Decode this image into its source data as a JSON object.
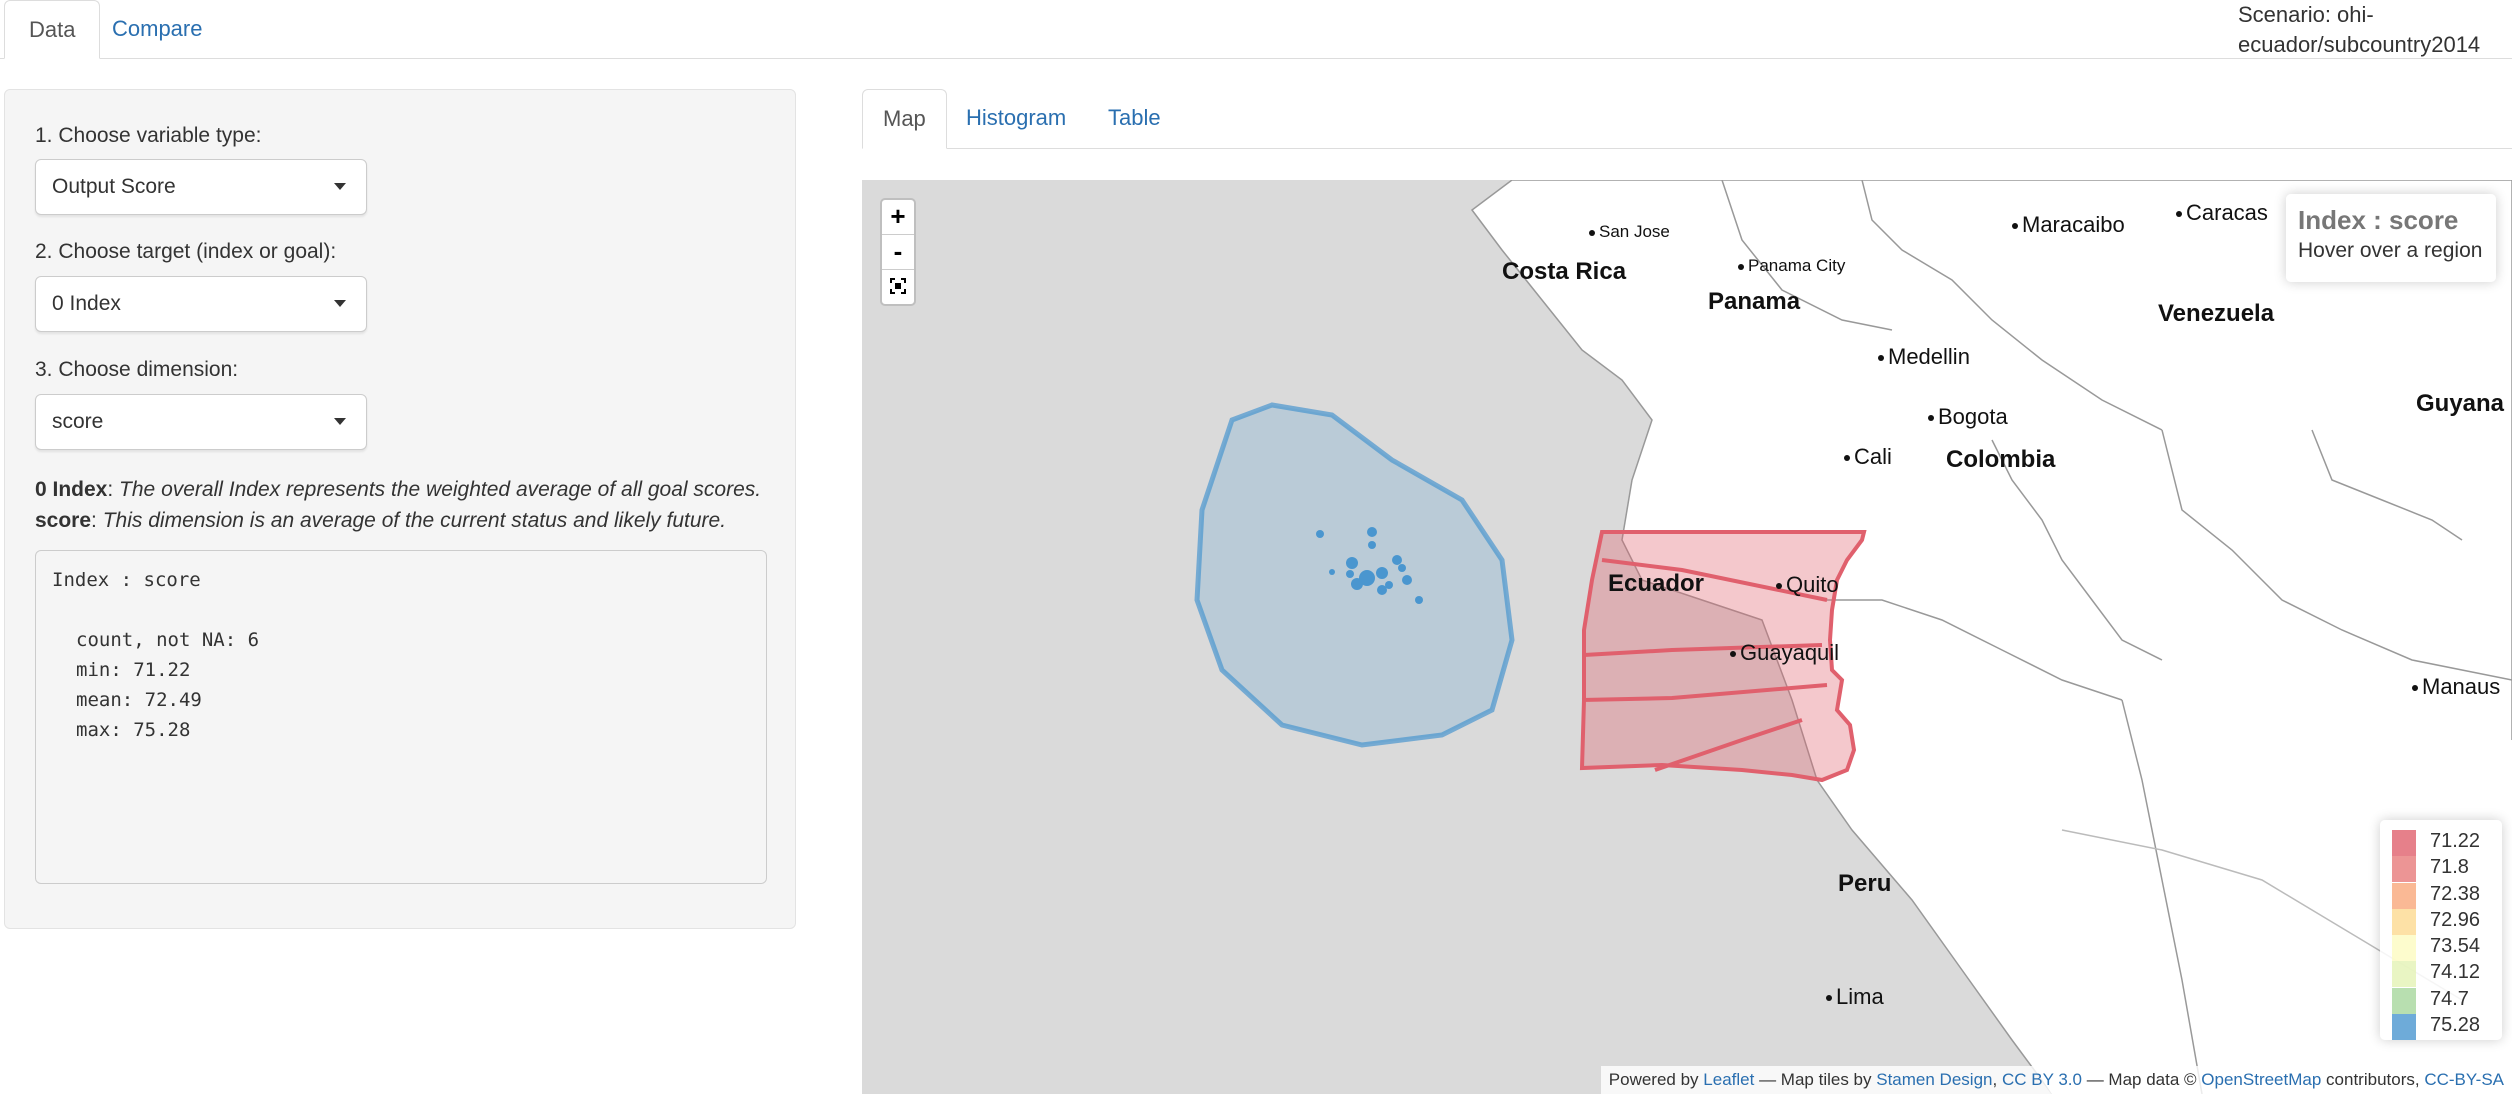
{
  "top_tabs": {
    "data": "Data",
    "compare": "Compare"
  },
  "scenario": "Scenario: ohi-ecuador/subcountry2014",
  "sidebar": {
    "var_type_label": "1. Choose variable type:",
    "var_type_value": "Output Score",
    "target_label": "2. Choose target (index or goal):",
    "target_value": "0 Index",
    "dimension_label": "3. Choose dimension:",
    "dimension_value": "score",
    "desc_target_name": "0 Index",
    "desc_target_text": "The overall Index represents the weighted average of all goal scores.",
    "desc_dim_name": "score",
    "desc_dim_text": "This dimension is an average of the current status and likely future.",
    "summary": {
      "title": "Index : score",
      "count": "count, not NA: 6",
      "min": "min: 71.22",
      "mean": "mean: 72.49",
      "max": "max: 75.28"
    }
  },
  "main_tabs": {
    "map": "Map",
    "histogram": "Histogram",
    "table": "Table"
  },
  "map": {
    "zoom_in": "+",
    "zoom_out": "-",
    "info_title": "Index : score",
    "info_hint": "Hover over a region",
    "labels": {
      "san_jose": "San Jose",
      "costa_rica": "Costa Rica",
      "panama_city": "Panama City",
      "panama": "Panama",
      "maracaibo": "Maracaibo",
      "caracas": "Caracas",
      "venezuela": "Venezuela",
      "medellin": "Medellin",
      "bogota": "Bogota",
      "cali": "Cali",
      "colombia": "Colombia",
      "guyana": "Guyana",
      "ecuador": "Ecuador",
      "quito": "Quito",
      "guayaquil": "Guayaquil",
      "manaus": "Manaus",
      "peru": "Peru",
      "lima": "Lima"
    },
    "legend": [
      {
        "value": "71.22",
        "color": "#e0606d"
      },
      {
        "value": "71.8",
        "color": "#e77a7a"
      },
      {
        "value": "72.38",
        "color": "#f9a77b"
      },
      {
        "value": "72.96",
        "color": "#fcd990"
      },
      {
        "value": "73.54",
        "color": "#fdfbc0"
      },
      {
        "value": "74.12",
        "color": "#e3f2b4"
      },
      {
        "value": "74.7",
        "color": "#a6d79c"
      },
      {
        "value": "75.28",
        "color": "#4a96cf"
      }
    ],
    "attribution": {
      "powered": "Powered by",
      "leaflet": "Leaflet",
      "tiles": "— Map tiles by",
      "stamen": "Stamen Design",
      "comma": ",",
      "ccby": "CC BY 3.0",
      "mapdata": "— Map data ©",
      "osm": "OpenStreetMap",
      "contrib": "contributors,",
      "ccbysa": "CC-BY-SA"
    }
  }
}
